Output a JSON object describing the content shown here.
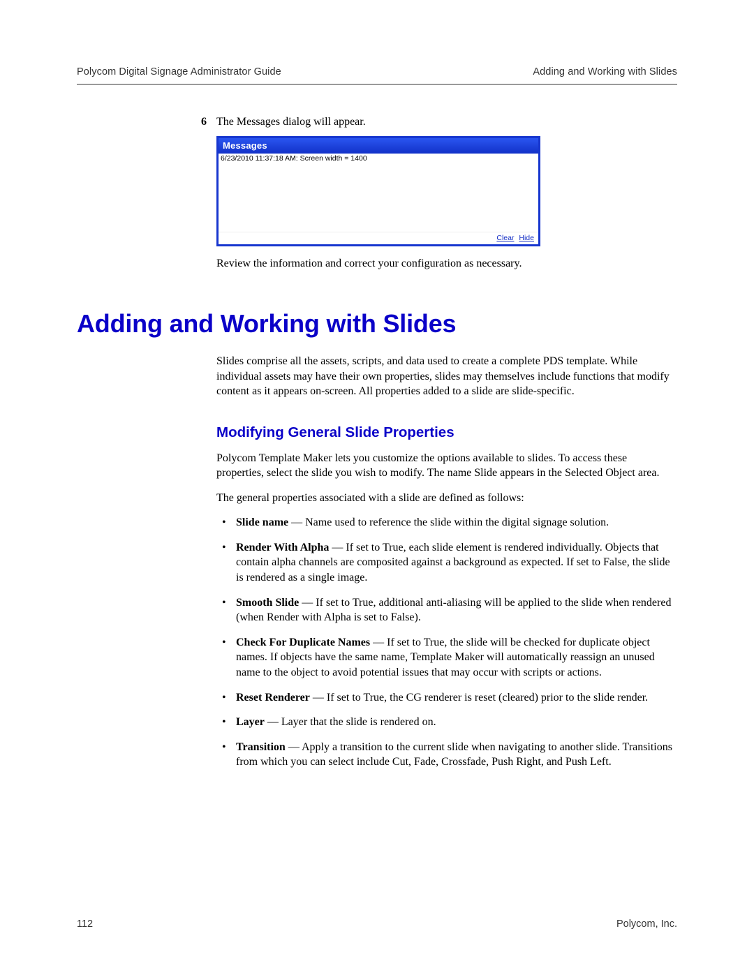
{
  "header": {
    "left": "Polycom Digital Signage Administrator Guide",
    "right": "Adding and Working with Slides"
  },
  "step": {
    "number": "6",
    "text": "The Messages dialog will appear."
  },
  "messages_window": {
    "title": "Messages",
    "log_line": "6/23/2010 11:37:18 AM: Screen width = 1400",
    "clear": "Clear",
    "hide": "Hide"
  },
  "review_line": "Review the information and correct your configuration as necessary.",
  "h1": "Adding and Working with Slides",
  "intro_para": "Slides comprise all the assets, scripts, and data used to create a complete PDS template. While individual assets may have their own properties, slides may themselves include functions that modify content as it appears on-screen. All properties added to a slide are slide-specific.",
  "h2": "Modifying General Slide Properties",
  "mod_para1": "Polycom Template Maker lets you customize the options available to slides. To access these properties, select the slide you wish to modify. The name Slide appears in the Selected Object area.",
  "mod_para2": "The general properties associated with a slide are defined as follows:",
  "props": [
    {
      "term": "Slide name",
      "desc": " — Name used to reference the slide within the digital signage solution."
    },
    {
      "term": "Render With Alpha",
      "desc": " — If set to True, each slide element is rendered individually. Objects that contain alpha channels are composited against a background as expected. If set to False, the slide is rendered as a single image."
    },
    {
      "term": "Smooth Slide",
      "desc": " — If set to True, additional anti-aliasing will be applied to the slide when rendered (when Render with Alpha is set to False)."
    },
    {
      "term": "Check For Duplicate Names",
      "desc": " — If set to True, the slide will be checked for duplicate object names. If objects have the same name, Template Maker will automatically reassign an unused name to the object to avoid potential issues that may occur with scripts or actions."
    },
    {
      "term": "Reset Renderer",
      "desc": " — If set to True, the CG renderer is reset (cleared) prior to the slide render."
    },
    {
      "term": "Layer",
      "desc": " — Layer that the slide is rendered on."
    },
    {
      "term": "Transition",
      "desc": " — Apply a transition to the current slide when navigating to another slide. Transitions from which you can select include Cut, Fade, Crossfade, Push Right, and Push Left."
    }
  ],
  "footer": {
    "page": "112",
    "company": "Polycom, Inc."
  }
}
